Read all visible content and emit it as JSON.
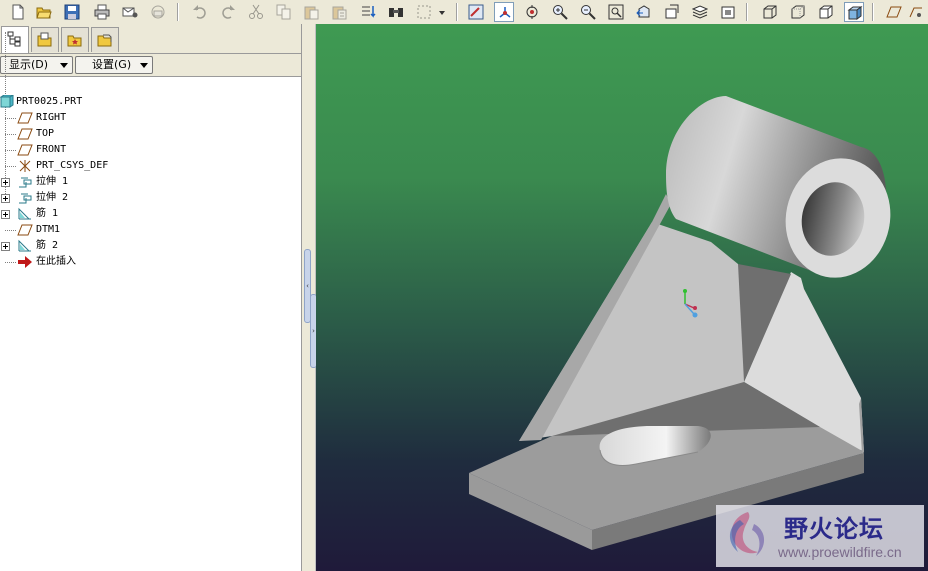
{
  "toolbar": {
    "items": [
      "new-file-icon",
      "open-folder-icon",
      "save-icon",
      "print-icon",
      "email-icon",
      "email-attach-icon",
      "undo-icon",
      "redo-icon",
      "cut-icon",
      "copy-icon",
      "paste-icon",
      "paste-special-icon",
      "regenerate-icon",
      "find-icon",
      "select-box-icon",
      "select-dropdown-icon",
      "repaint-icon",
      "spin-center-icon",
      "orient-icon",
      "zoom-in-icon",
      "zoom-out-icon",
      "refit-icon",
      "reorient-icon",
      "view-manager-icon",
      "layers-icon",
      "saved-view-icon",
      "wireframe-icon",
      "hidden-line-icon",
      "no-hidden-icon",
      "shading-icon",
      "datum-plane-display-icon"
    ]
  },
  "nav_tabs": [
    "model-tree-tab",
    "folder-browser-tab",
    "favorites-tab",
    "connections-tab"
  ],
  "menu": {
    "display_label": "显示(D)",
    "settings_label": "设置(G)"
  },
  "tree": {
    "root": "PRT0025.PRT",
    "items": [
      {
        "label": "RIGHT",
        "icon": "datum-plane-icon",
        "expandable": false
      },
      {
        "label": "TOP",
        "icon": "datum-plane-icon",
        "expandable": false
      },
      {
        "label": "FRONT",
        "icon": "datum-plane-icon",
        "expandable": false
      },
      {
        "label": "PRT_CSYS_DEF",
        "icon": "csys-icon",
        "expandable": false
      },
      {
        "label": "拉伸 1",
        "icon": "extrude-icon",
        "expandable": true
      },
      {
        "label": "拉伸 2",
        "icon": "extrude-icon",
        "expandable": true
      },
      {
        "label": "筋 1",
        "icon": "rib-icon",
        "expandable": true
      },
      {
        "label": "DTM1",
        "icon": "datum-plane-icon",
        "expandable": false
      },
      {
        "label": "筋 2",
        "icon": "rib-icon",
        "expandable": true
      },
      {
        "label": "在此插入",
        "icon": "insert-here-icon",
        "expandable": false
      }
    ]
  },
  "colors": {
    "viewport_top": "#3f9a52",
    "viewport_bottom": "#1f1a3a",
    "model_light": "#d6d6d6",
    "model_dark": "#6e6e6e",
    "watermark_text": "#2b2a8a"
  },
  "watermark": {
    "title": "野火论坛",
    "url": "www.proewildfire.cn"
  }
}
